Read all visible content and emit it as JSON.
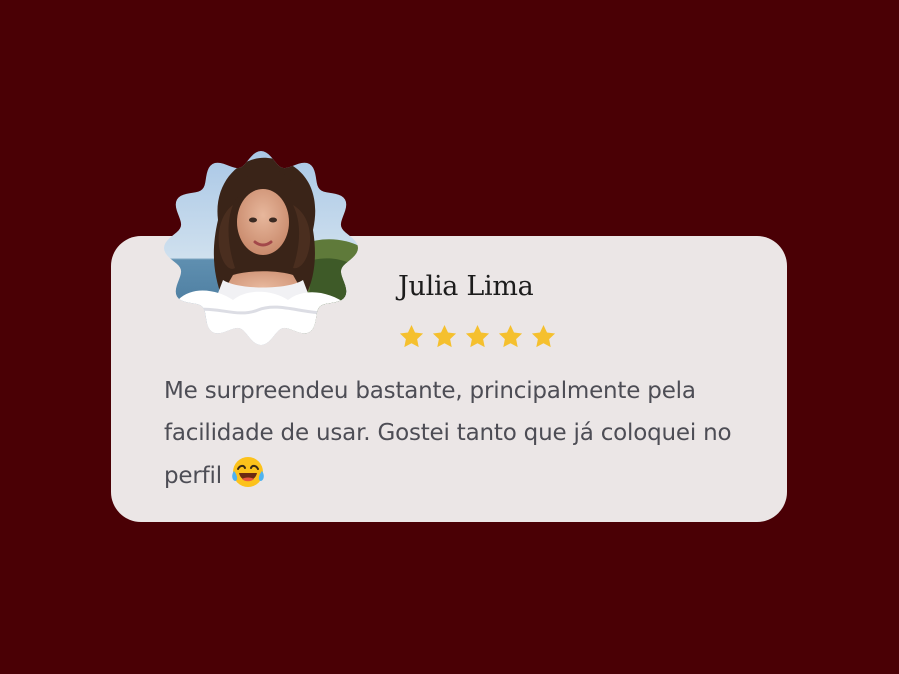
{
  "testimonial": {
    "name": "Julia Lima",
    "rating": 5,
    "rating_max": 5,
    "review_text": "Me surpreendeu bastante, principalmente pela facilidade de usar. Gostei tanto que já coloquei no perfil",
    "emoji": "😂",
    "avatar_icon": "user-photo-avatar"
  },
  "colors": {
    "background": "#4a0005",
    "card": "#ebe6e6",
    "star": "#f5c02e",
    "name_text": "#1c1c1c",
    "review_text": "#4d4d55"
  }
}
